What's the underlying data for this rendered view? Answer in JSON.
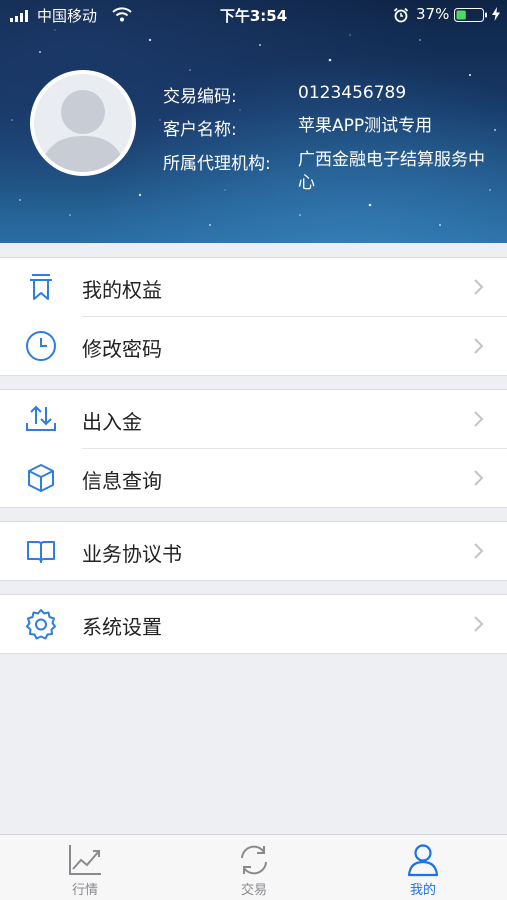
{
  "status_bar": {
    "carrier": "中国移动",
    "time": "下午3:54",
    "battery_percent": "37%",
    "battery_level": 0.37
  },
  "profile": {
    "trade_code_label": "交易编码:",
    "trade_code_value": "0123456789",
    "customer_name_label": "客户名称:",
    "customer_name_value": "苹果APP测试专用",
    "agency_label": "所属代理机构:",
    "agency_value": "广西金融电子结算服务中心"
  },
  "menu": {
    "rights": "我的权益",
    "change_password": "修改密码",
    "deposit_withdraw": "出入金",
    "info_query": "信息查询",
    "agreement": "业务协议书",
    "settings": "系统设置"
  },
  "tabbar": {
    "market": "行情",
    "trade": "交易",
    "mine": "我的"
  },
  "colors": {
    "accent": "#1a73e8",
    "icon_blue": "#2f7de1",
    "header_dark": "#0f2446",
    "header_light": "#2a6ea3",
    "background": "#eeeff3"
  }
}
